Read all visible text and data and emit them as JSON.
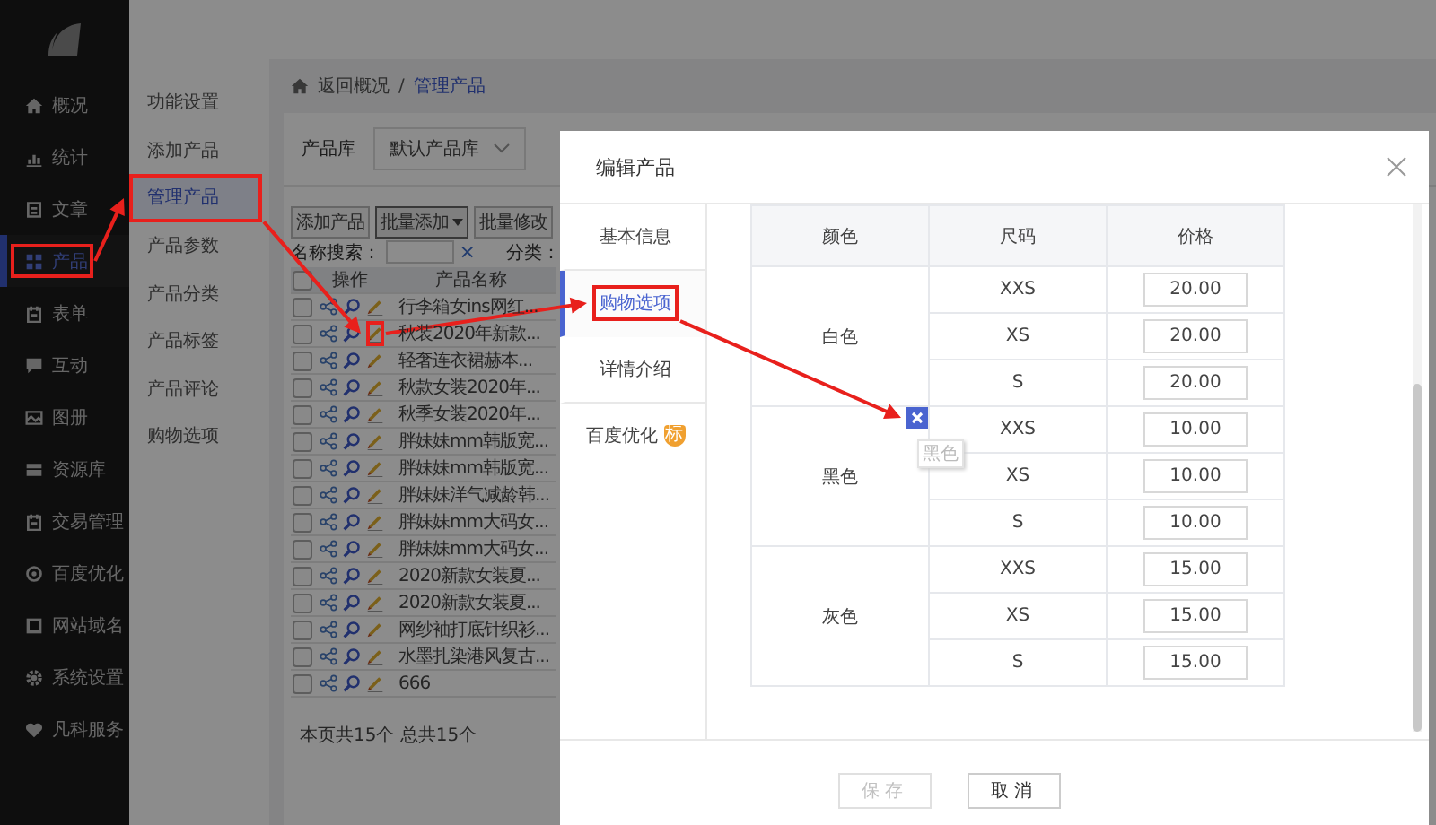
{
  "sidebar": {
    "items": [
      {
        "label": "概况",
        "selected": false,
        "highlighted": false
      },
      {
        "label": "统计",
        "selected": false,
        "highlighted": false
      },
      {
        "label": "文章",
        "selected": false,
        "highlighted": false
      },
      {
        "label": "产品",
        "selected": true,
        "highlighted": true
      },
      {
        "label": "表单",
        "selected": false,
        "highlighted": false
      },
      {
        "label": "互动",
        "selected": false,
        "highlighted": false
      },
      {
        "label": "图册",
        "selected": false,
        "highlighted": false
      },
      {
        "label": "资源库",
        "selected": false,
        "highlighted": false
      },
      {
        "label": "交易管理",
        "selected": false,
        "highlighted": false
      },
      {
        "label": "百度优化",
        "selected": false,
        "highlighted": false
      },
      {
        "label": "网站域名",
        "selected": false,
        "highlighted": false
      },
      {
        "label": "系统设置",
        "selected": false,
        "highlighted": false
      },
      {
        "label": "凡科服务",
        "selected": false,
        "highlighted": false
      }
    ]
  },
  "submenu": {
    "items": [
      {
        "label": "功能设置",
        "selected": false,
        "highlighted": false
      },
      {
        "label": "添加产品",
        "selected": false,
        "highlighted": false
      },
      {
        "label": "管理产品",
        "selected": true,
        "highlighted": true
      },
      {
        "label": "产品参数",
        "selected": false,
        "highlighted": false
      },
      {
        "label": "产品分类",
        "selected": false,
        "highlighted": false
      },
      {
        "label": "产品标签",
        "selected": false,
        "highlighted": false
      },
      {
        "label": "产品评论",
        "selected": false,
        "highlighted": false
      },
      {
        "label": "购物选项",
        "selected": false,
        "highlighted": false
      }
    ]
  },
  "breadcrumb": {
    "back": "返回概况",
    "separator": "/",
    "current": "管理产品"
  },
  "library": {
    "label": "产品库",
    "value": "默认产品库"
  },
  "toolbar": {
    "buttons": [
      {
        "label": "添加产品",
        "dropdown": false
      },
      {
        "label": "批量添加",
        "dropdown": true
      },
      {
        "label": "批量修改",
        "dropdown": false
      }
    ]
  },
  "search": {
    "label": "名称搜索：",
    "clear": "×",
    "category_label": "分类："
  },
  "product_table": {
    "columns": [
      "操作",
      "产品名称"
    ],
    "header_checked": false,
    "rows": [
      {
        "checked": false,
        "name": "行李箱女ins网红...",
        "edit_highlighted": false
      },
      {
        "checked": false,
        "name": "秋装2020年新款...",
        "edit_highlighted": true
      },
      {
        "checked": false,
        "name": "轻奢连衣裙赫本...",
        "edit_highlighted": false
      },
      {
        "checked": false,
        "name": "秋款女装2020年...",
        "edit_highlighted": false
      },
      {
        "checked": false,
        "name": "秋季女装2020年...",
        "edit_highlighted": false
      },
      {
        "checked": false,
        "name": "胖妹妹mm韩版宽...",
        "edit_highlighted": false
      },
      {
        "checked": false,
        "name": "胖妹妹mm韩版宽...",
        "edit_highlighted": false
      },
      {
        "checked": false,
        "name": "胖妹妹洋气减龄韩...",
        "edit_highlighted": false
      },
      {
        "checked": false,
        "name": "胖妹妹mm大码女...",
        "edit_highlighted": false
      },
      {
        "checked": false,
        "name": "胖妹妹mm大码女...",
        "edit_highlighted": false
      },
      {
        "checked": false,
        "name": "2020新款女装夏...",
        "edit_highlighted": false
      },
      {
        "checked": false,
        "name": "2020新款女装夏...",
        "edit_highlighted": false
      },
      {
        "checked": false,
        "name": "网纱袖打底针织衫...",
        "edit_highlighted": false
      },
      {
        "checked": false,
        "name": "水墨扎染港风复古...",
        "edit_highlighted": false
      },
      {
        "checked": false,
        "name": "666",
        "edit_highlighted": false
      }
    ]
  },
  "summary": "本页共15个 总共15个",
  "modal": {
    "title": "编辑产品",
    "tabs": [
      {
        "label": "基本信息",
        "selected": false,
        "highlighted": false
      },
      {
        "label": "购物选项",
        "selected": true,
        "highlighted": true
      },
      {
        "label": "详情介绍",
        "selected": false,
        "highlighted": false
      },
      {
        "label": "百度优化",
        "selected": false,
        "highlighted": false,
        "badge": "标"
      }
    ],
    "table": {
      "columns": [
        "颜色",
        "尺码",
        "价格"
      ],
      "groups": [
        {
          "name": "白色",
          "hovered": false,
          "sizes": [
            {
              "size": "XXS",
              "price": "20.00"
            },
            {
              "size": "XS",
              "price": "20.00"
            },
            {
              "size": "S",
              "price": "20.00"
            }
          ]
        },
        {
          "name": "黑色",
          "hovered": true,
          "tooltip": "黑色",
          "sizes": [
            {
              "size": "XXS",
              "price": "10.00"
            },
            {
              "size": "XS",
              "price": "10.00"
            },
            {
              "size": "S",
              "price": "10.00"
            }
          ]
        },
        {
          "name": "灰色",
          "hovered": false,
          "sizes": [
            {
              "size": "XXS",
              "price": "15.00"
            },
            {
              "size": "XS",
              "price": "15.00"
            },
            {
              "size": "S",
              "price": "15.00"
            }
          ]
        }
      ]
    },
    "buttons": [
      {
        "label": "保存",
        "disabled": true
      },
      {
        "label": "取消",
        "disabled": false
      }
    ]
  }
}
